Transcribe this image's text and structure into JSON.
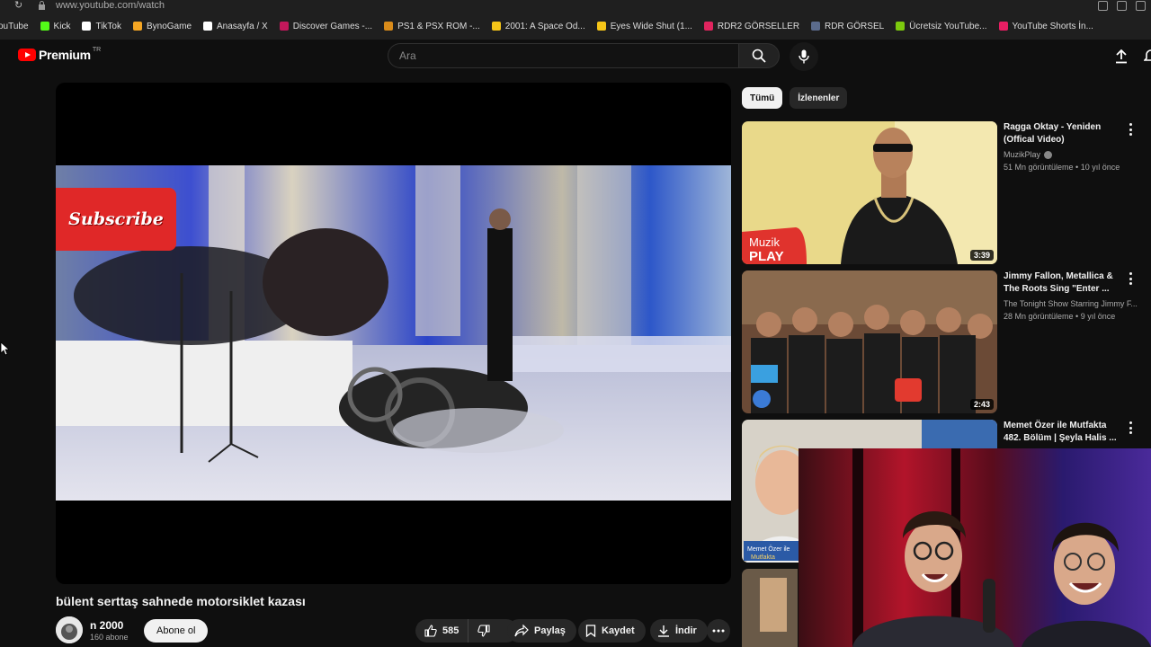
{
  "browser": {
    "partial_tab": "ouTube",
    "url": "www.youtube.com/watch",
    "bookmarks": [
      {
        "label": "Kick",
        "color": "#53fc18"
      },
      {
        "label": "TikTok",
        "color": "#ffffff"
      },
      {
        "label": "BynoGame",
        "color": "#f5a623"
      },
      {
        "label": "Anasayfa / X",
        "color": "#ffffff"
      },
      {
        "label": "Discover Games -...",
        "color": "#c2185b"
      },
      {
        "label": "PS1 & PSX ROM -...",
        "color": "#d98b1a"
      },
      {
        "label": "2001: A Space Od...",
        "color": "#f5c518"
      },
      {
        "label": "Eyes Wide Shut (1...",
        "color": "#f5c518"
      },
      {
        "label": "RDR2 GÖRSELLER",
        "color": "#e0245e"
      },
      {
        "label": "RDR GÖRSEL",
        "color": "#5b6b8c"
      },
      {
        "label": "Ücretsiz YouTube...",
        "color": "#7cc90d"
      },
      {
        "label": "YouTube Shorts İn...",
        "color": "#e91e63"
      }
    ]
  },
  "header": {
    "logo_text": "Premium",
    "logo_badge": "TR",
    "search_placeholder": "Ara"
  },
  "video": {
    "title": "bülent serttaş sahnede motorsiklet kazası",
    "overlay_text": "Subscribe",
    "channel_name": "n 2000",
    "subscribers": "160 abone",
    "subscribe_label": "Abone ol",
    "likes": "585",
    "share_label": "Paylaş",
    "save_label": "Kaydet",
    "download_label": "İndir"
  },
  "sidebar": {
    "chips": [
      {
        "label": "Tümü",
        "active": true
      },
      {
        "label": "İzlenenler",
        "active": false
      }
    ],
    "recommendations": [
      {
        "title": "Ragga Oktay - Yeniden (Offical Video)",
        "channel": "MuzikPlay",
        "verified": true,
        "meta": "51 Mn görüntüleme • 10 yıl önce",
        "duration": "3:39",
        "thumb_text": "Muzik PLAY"
      },
      {
        "title": "Jimmy Fallon, Metallica & The Roots Sing \"Enter ...",
        "channel": "The Tonight Show Starring Jimmy F...",
        "verified": false,
        "meta": "28 Mn görüntüleme • 9 yıl önce",
        "duration": "2:43"
      },
      {
        "title": "Memet Özer ile Mutfakta 482. Bölüm | Şeyla Halis ...",
        "channel": "",
        "verified": false,
        "meta": "",
        "duration": "",
        "thumb_text": "Memet Özer ile Mutfakta"
      }
    ]
  }
}
